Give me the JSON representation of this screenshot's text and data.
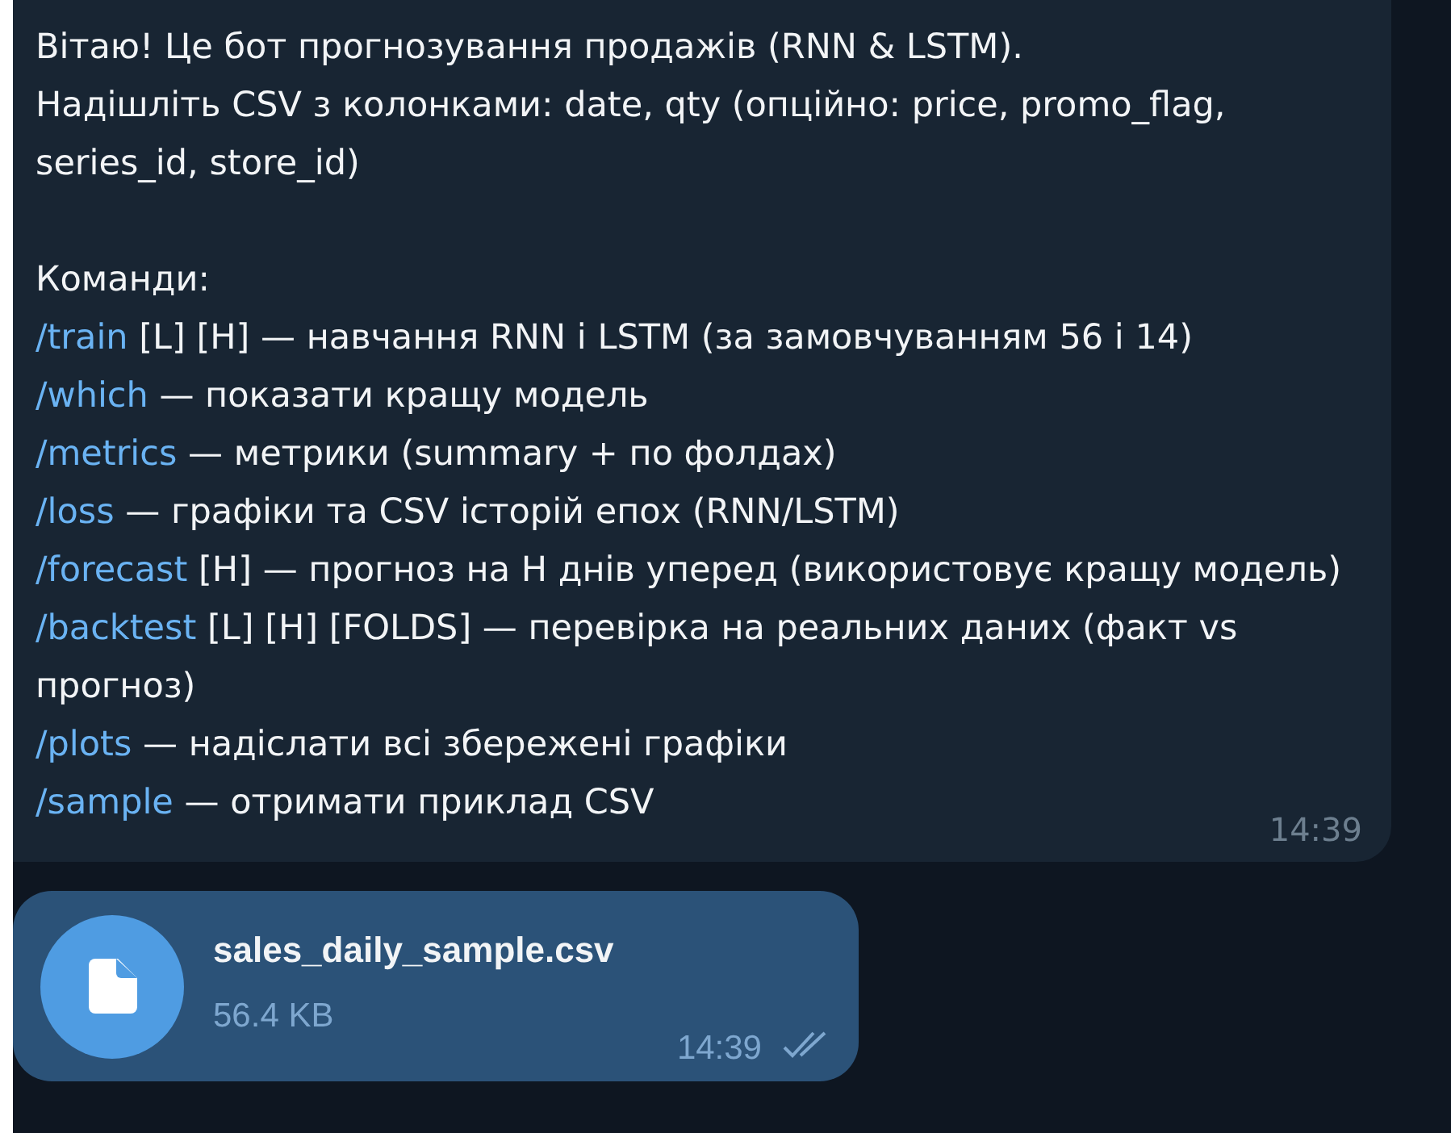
{
  "messages": [
    {
      "kind": "text",
      "intro": [
        "Вітаю! Це бот прогнозування продажів (RNN & LSTM).",
        "Надішліть CSV з колонками: date, qty (опційно: price, promo_flag, series_id, store_id)"
      ],
      "heading": "Команди:",
      "commands": [
        {
          "command": "/train",
          "text": " [L] [H] — навчання RNN і LSTM (за замовчуванням 56 і 14)"
        },
        {
          "command": "/which",
          "text": " — показати кращу модель"
        },
        {
          "command": "/metrics",
          "text": " — метрики (summary + по фолдах)"
        },
        {
          "command": "/loss",
          "text": " — графіки та CSV історій епох (RNN/LSTM)"
        },
        {
          "command": "/forecast",
          "text": " [H] — прогноз на H днів уперед (використовує кращу модель)"
        },
        {
          "command": "/backtest",
          "text": " [L] [H] [FOLDS] — перевірка на реальних даних (факт vs прогноз)"
        },
        {
          "command": "/plots",
          "text": " — надіслати всі збережені графіки"
        },
        {
          "command": "/sample",
          "text": " — отримати приклад CSV"
        }
      ],
      "time": "14:39"
    },
    {
      "kind": "file",
      "file_name": "sales_daily_sample.csv",
      "size": "56.4 KB",
      "time": "14:39",
      "read": true
    }
  ]
}
